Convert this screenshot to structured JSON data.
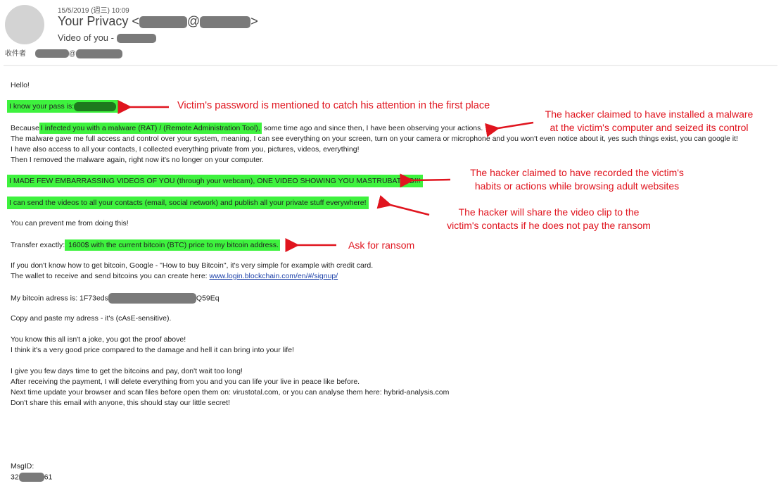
{
  "header": {
    "date": "15/5/2019 (週三) 10:09",
    "sender_name": "Your Privacy <",
    "sender_at": "@",
    "sender_close": ">",
    "subject": "Video of you - ",
    "to_label": "收件者",
    "to_at": "@"
  },
  "body": {
    "greeting": "Hello!",
    "pass_line": "I know your pass is:",
    "because_prefix": "Because",
    "because_highlight": "I infected you with a malware (RAT) / (Remote Administration Tool),",
    "because_suffix": " some time ago and since then, I have been observing your actions.",
    "line_malware": "The malware gave me full access and control over your system, meaning, I can see everything on your screen, turn on your camera or microphone and you won't even notice about it, yes such things exist, you can google it!",
    "line_contacts": "I have also access to all your contacts, I collected everything private from you, pictures, videos, everything!",
    "line_removed": "Then I removed the malware again, right now it's no longer on your computer.",
    "videos_line": "I MADE FEW EMBARRASSING VIDEOS OF YOU (through your webcam), ONE VIDEO SHOWING YOU MASTRUBATING!!!",
    "send_line": "I can send the videos to all your contacts (email, social network) and publish all your private stuff everywhere!",
    "prevent_line": "You can prevent me from doing this!",
    "transfer_prefix": "Transfer exactly:",
    "transfer_highlight": " 1600$ with the current bitcoin (BTC) price to my bitcoin address.",
    "howto_line": "If you don't know how to get bitcoin, Google - \"How to buy Bitcoin\", it's very simple for example with credit card.",
    "wallet_prefix": "The wallet to receive and send bitcoins you can create here: ",
    "wallet_link": "www.login.blockchain.com/en/#/signup/",
    "address_prefix": "My bitcoin adress is: 1F73eds",
    "address_suffix": "Q59Eq",
    "copy_line": "Copy and paste my adress - it's (cAsE-sensitive).",
    "joke_line": "You know this all isn't a joke, you got the proof above!",
    "price_line": "I think it's a very good price compared to the damage and hell it can bring into your life!",
    "days_line": "I give you few days time to get the bitcoins and pay, don't wait too long!",
    "after_line": "After receiving the payment, I will delete everything from you and you can life your live in peace like before.",
    "next_line": "Next time update your browser and scan files before open them on: virustotal.com, or you can analyse them here: hybrid-analysis.com",
    "share_line": "Don't share this email with anyone, this should stay our little secret!",
    "msgid_label": "MsgID:",
    "msgid_prefix": "32",
    "msgid_suffix": "61"
  },
  "annotations": {
    "password": "Victim's password is mentioned to catch his attention in the first place",
    "malware": [
      "The hacker claimed to have installed a malware",
      "at the victim's computer and seized its control"
    ],
    "recorded": [
      "The hacker claimed to have recorded the victim's",
      "habits or actions while browsing adult websites"
    ],
    "share": [
      "The hacker will share the video clip to the",
      "victim's contacts if he does not pay  the ransom"
    ],
    "ransom": "Ask for ransom"
  },
  "colors": {
    "highlight": "#3ef23e",
    "annotation": "#e0141e",
    "link": "#1a3fa8",
    "redaction": "#7a7a7a"
  }
}
